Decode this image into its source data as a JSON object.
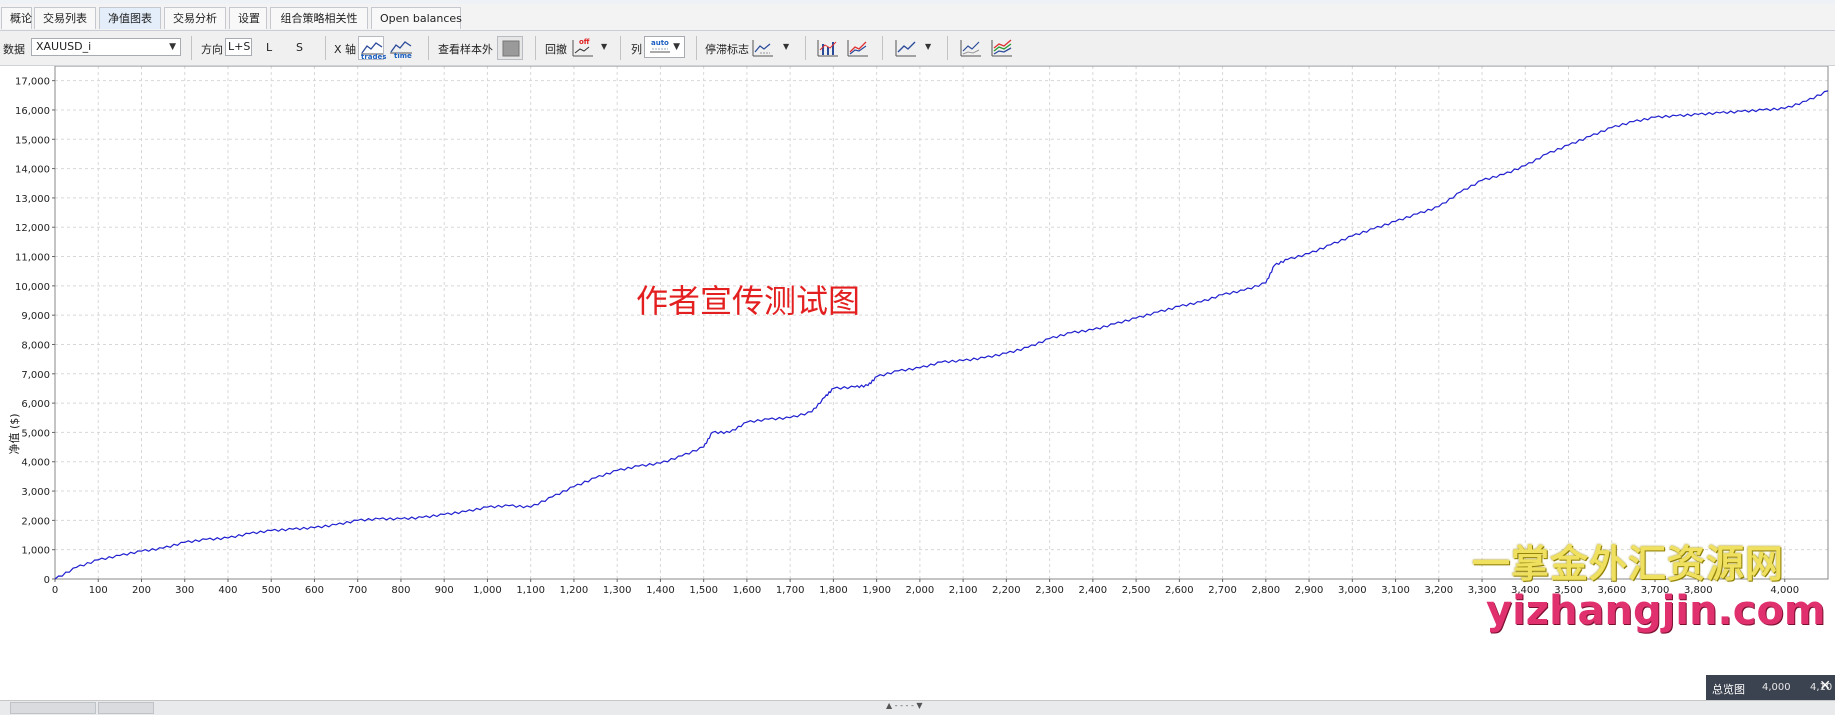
{
  "tabs": [
    "概论",
    "交易列表",
    "净值图表",
    "交易分析",
    "设置",
    "组合策略相关性",
    "Open balances"
  ],
  "active_tab": "净值图表",
  "toolbar": {
    "data_label": "数据",
    "data_value": "XAUUSD_i",
    "direction_label": "方向",
    "direction_options": [
      "L+S",
      "L",
      "S"
    ],
    "xaxis_label": "X 轴",
    "xaxis_trades": "trades",
    "xaxis_time": "time",
    "oos_label": "查看样本外",
    "drawdown_label": "回撤",
    "drawdown_state": "off",
    "column_label": "列",
    "column_value": "auto",
    "stagnation_label": "停滞标志",
    "icons": [
      "equity-icon",
      "monthly-bars-icon",
      "trend-icon",
      "compare-icon",
      "multi-series-icon"
    ]
  },
  "chart_data": {
    "type": "line",
    "title": "",
    "xlabel": "",
    "ylabel": "净值 ($)",
    "xlim": [
      0,
      4100
    ],
    "ylim": [
      0,
      17500
    ],
    "x_ticks": [
      0,
      100,
      200,
      300,
      400,
      500,
      600,
      700,
      800,
      900,
      1000,
      1100,
      1200,
      1300,
      1400,
      1500,
      1600,
      1700,
      1800,
      1900,
      2000,
      2100,
      2200,
      2300,
      2400,
      2500,
      2600,
      2700,
      2800,
      2900,
      3000,
      3100,
      3200,
      3300,
      3400,
      3500,
      3600,
      3700,
      3800,
      4000
    ],
    "y_ticks": [
      0,
      1000,
      2000,
      3000,
      4000,
      5000,
      6000,
      7000,
      8000,
      9000,
      10000,
      11000,
      12000,
      13000,
      14000,
      15000,
      16000,
      17000
    ],
    "grid": true,
    "color": "#1f1fcf",
    "series": [
      {
        "x": [
          0,
          50,
          100,
          150,
          200,
          250,
          300,
          350,
          400,
          450,
          500,
          550,
          600,
          650,
          700,
          750,
          800,
          850,
          900,
          950,
          1000,
          1050,
          1100,
          1150,
          1200,
          1250,
          1300,
          1350,
          1400,
          1450,
          1500,
          1520,
          1560,
          1600,
          1650,
          1700,
          1750,
          1780,
          1800,
          1850,
          1880,
          1900,
          1950,
          2000,
          2050,
          2100,
          2150,
          2200,
          2250,
          2300,
          2350,
          2400,
          2450,
          2500,
          2550,
          2600,
          2650,
          2700,
          2750,
          2800,
          2820,
          2850,
          2900,
          2950,
          3000,
          3050,
          3100,
          3150,
          3200,
          3250,
          3300,
          3350,
          3400,
          3450,
          3500,
          3550,
          3600,
          3650,
          3700,
          3750,
          3800,
          3850,
          3900,
          3950,
          4000,
          4050,
          4100
        ],
        "y": [
          0,
          400,
          650,
          800,
          950,
          1050,
          1250,
          1350,
          1400,
          1550,
          1650,
          1700,
          1750,
          1850,
          2000,
          2050,
          2050,
          2100,
          2200,
          2300,
          2450,
          2500,
          2450,
          2800,
          3150,
          3450,
          3700,
          3850,
          3950,
          4200,
          4500,
          5000,
          5000,
          5350,
          5450,
          5500,
          5700,
          6200,
          6500,
          6550,
          6600,
          6900,
          7100,
          7200,
          7400,
          7450,
          7550,
          7700,
          7900,
          8200,
          8400,
          8500,
          8700,
          8900,
          9100,
          9300,
          9450,
          9700,
          9850,
          10100,
          10700,
          10900,
          11100,
          11400,
          11700,
          11950,
          12200,
          12450,
          12700,
          13200,
          13600,
          13800,
          14100,
          14500,
          14800,
          15100,
          15400,
          15600,
          15750,
          15800,
          15850,
          15900,
          15950,
          16000,
          16050,
          16300,
          16650
        ]
      }
    ]
  },
  "promo_text": "作者宣传测试图",
  "watermark_line1": "一掌金外汇资源网",
  "watermark_line2": "yizhangjin.com",
  "overview": {
    "label": "总览图",
    "tick1": "4,000",
    "tick2": "4,10"
  }
}
